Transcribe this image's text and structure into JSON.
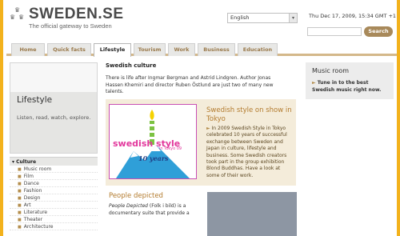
{
  "header": {
    "logo_title": "SWEDEN.SE",
    "logo_subtitle": "The official gateway to Sweden",
    "language": "English",
    "datetime": "Thu Dec 17, 2009, 15:34 GMT +1",
    "search_label": "Search"
  },
  "nav": {
    "tabs": [
      {
        "label": "Home"
      },
      {
        "label": "Quick facts"
      },
      {
        "label": "Lifestyle"
      },
      {
        "label": "Tourism"
      },
      {
        "label": "Work"
      },
      {
        "label": "Business"
      },
      {
        "label": "Education"
      }
    ]
  },
  "sidebar": {
    "title": "Lifestyle",
    "tagline": "Listen, read, watch, explore.",
    "menu_head": "Culture",
    "items": [
      {
        "label": "Music room"
      },
      {
        "label": "Film"
      },
      {
        "label": "Dance"
      },
      {
        "label": "Fashion"
      },
      {
        "label": "Design"
      },
      {
        "label": "Art"
      },
      {
        "label": "Literature"
      },
      {
        "label": "Theater"
      },
      {
        "label": "Architecture"
      }
    ]
  },
  "main": {
    "title": "Swedish culture",
    "intro": "There is life after Ingmar Bergman and Astrid Lindgren. Author Jonas Hassen Khemiri and director Ruben Östlund are just two of many new talents.",
    "feature": {
      "title": "Swedish style on show in Tokyo",
      "text": "In 2009 Swedish Style in Tokyo celebrated 10 years of successful exchange between Sweden and Japan in culture, lifestyle and business. Some Swedish creators took part in the group exhibition Blond Buddhas. Have a look at some of their work.",
      "image_text": "swedish style",
      "image_sub": "in Tokyo 09",
      "image_years": "10 years"
    },
    "people": {
      "title": "People depicted",
      "text_em": "People Depicted",
      "text_rest": "(Folk i bild) is a documentary suite that provide a"
    }
  },
  "right": {
    "title": "Music room",
    "link": "Tune in to the best Swedish music right now."
  },
  "colors": {
    "background": "#f3b21c",
    "accent": "#b37b2e",
    "feature_bg": "#f4ecda"
  }
}
